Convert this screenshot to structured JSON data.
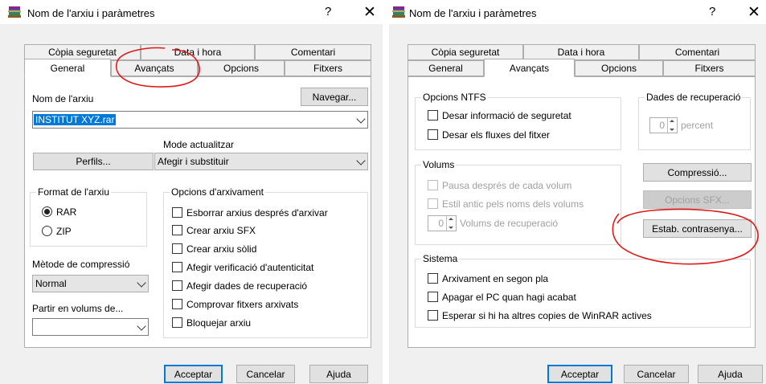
{
  "dialog_left": {
    "title": "Nom de l'arxiu i paràmetres",
    "help_glyph": "?",
    "close_glyph": "✕",
    "tabs_back": [
      "Còpia seguretat",
      "Data i hora",
      "Comentari"
    ],
    "tabs_front": [
      "General",
      "Avançats",
      "Opcions",
      "Fitxers"
    ],
    "active_tab": "General",
    "archive_name_label": "Nom de l'arxiu",
    "browse_button": "Navegar...",
    "archive_name_value": "INSTITUT XYZ.rar",
    "profiles_button": "Perfils...",
    "update_mode_label": "Mode actualitzar",
    "update_mode_value": "Afegir i substituir",
    "format_group": {
      "label": "Format de l'arxiu",
      "options": [
        {
          "label": "RAR",
          "checked": true
        },
        {
          "label": "ZIP",
          "checked": false
        }
      ]
    },
    "archive_options": {
      "label": "Opcions d'arxivament",
      "items": [
        "Esborrar arxius després d'arxivar",
        "Crear arxiu SFX",
        "Crear arxiu sòlid",
        "Afegir verificació d'autenticitat",
        "Afegir dades de recuperació",
        "Comprovar fitxers arxivats",
        "Bloquejar arxiu"
      ]
    },
    "compression_label": "Mètode de compressió",
    "compression_value": "Normal",
    "split_label": "Partir en volums de...",
    "split_value": "",
    "footer": {
      "ok": "Acceptar",
      "cancel": "Cancelar",
      "help": "Ajuda"
    }
  },
  "dialog_right": {
    "title": "Nom de l'arxiu i paràmetres",
    "help_glyph": "?",
    "close_glyph": "✕",
    "tabs_back": [
      "Còpia seguretat",
      "Data i hora",
      "Comentari"
    ],
    "tabs_front": [
      "General",
      "Avançats",
      "Opcions",
      "Fitxers"
    ],
    "active_tab": "Avançats",
    "ntfs": {
      "label": "Opcions NTFS",
      "items": [
        "Desar informació de seguretat",
        "Desar els fluxes del fitxer"
      ]
    },
    "recovery": {
      "label": "Dades de recuperació",
      "value": "0",
      "unit": "percent"
    },
    "volumes": {
      "label": "Volums",
      "items": [
        "Pausa després de cada volum",
        "Estil antic pels noms dels volums"
      ],
      "recovery_value": "0",
      "recovery_label": "Volums de recuperació"
    },
    "compression_button": "Compressió...",
    "sfx_button": "Opcions SFX...",
    "password_button": "Estab. contrasenya...",
    "system": {
      "label": "Sistema",
      "items": [
        "Arxivament en segon pla",
        "Apagar el PC quan hagi acabat",
        "Esperar si hi ha altres copies de WinRAR actives"
      ]
    },
    "footer": {
      "ok": "Acceptar",
      "cancel": "Cancelar",
      "help": "Ajuda"
    }
  },
  "colors": {
    "accent": "#0078d7",
    "annotation": "#e01818",
    "dialog_bg": "#f0f0f0"
  }
}
